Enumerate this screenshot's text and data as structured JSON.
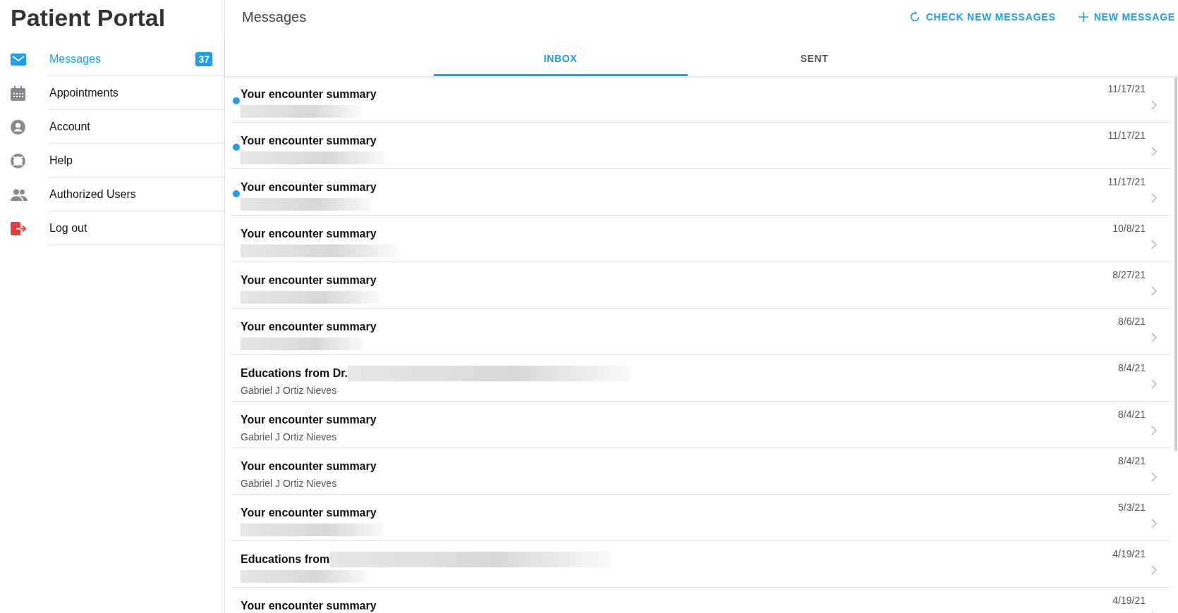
{
  "sidebar": {
    "title": "Patient Portal",
    "items": [
      {
        "label": "Messages",
        "kind": "mail",
        "selected": true,
        "badge": "37"
      },
      {
        "label": "Appointments",
        "kind": "calendar",
        "selected": false
      },
      {
        "label": "Account",
        "kind": "account",
        "selected": false
      },
      {
        "label": "Help",
        "kind": "help",
        "selected": false
      },
      {
        "label": "Authorized Users",
        "kind": "users",
        "selected": false
      },
      {
        "label": "Log out",
        "kind": "logout",
        "selected": false
      }
    ]
  },
  "header": {
    "title": "Messages",
    "actions": [
      {
        "label": "CHECK NEW MESSAGES",
        "kind": "refresh"
      },
      {
        "label": "NEW MESSAGE",
        "kind": "plus"
      }
    ]
  },
  "tabs": [
    {
      "label": "INBOX",
      "selected": true
    },
    {
      "label": "SENT",
      "selected": false
    }
  ],
  "messages": [
    {
      "title": "Your encounter summary",
      "title_redacted": false,
      "sender_redacted": true,
      "unread": true,
      "date": "11/17/21"
    },
    {
      "title": "Your encounter summary",
      "title_redacted": false,
      "sender_redacted": true,
      "unread": true,
      "date": "11/17/21"
    },
    {
      "title": "Your encounter summary",
      "title_redacted": false,
      "sender_redacted": true,
      "unread": true,
      "date": "11/17/21"
    },
    {
      "title": "Your encounter summary",
      "title_redacted": false,
      "sender_redacted": true,
      "unread": false,
      "date": "10/8/21"
    },
    {
      "title": "Your encounter summary",
      "title_redacted": false,
      "sender_redacted": true,
      "unread": false,
      "date": "8/27/21"
    },
    {
      "title": "Your encounter summary",
      "title_redacted": false,
      "sender_redacted": true,
      "unread": false,
      "date": "8/6/21"
    },
    {
      "title": "Educations from Dr.",
      "title_redacted": true,
      "sender": "Gabriel J Ortiz Nieves",
      "sender_redacted": false,
      "unread": false,
      "date": "8/4/21"
    },
    {
      "title": "Your encounter summary",
      "title_redacted": false,
      "sender": "Gabriel J Ortiz Nieves",
      "sender_redacted": false,
      "unread": false,
      "date": "8/4/21"
    },
    {
      "title": "Your encounter summary",
      "title_redacted": false,
      "sender": "Gabriel J Ortiz Nieves",
      "sender_redacted": false,
      "unread": false,
      "date": "8/4/21"
    },
    {
      "title": "Your encounter summary",
      "title_redacted": false,
      "sender_redacted": true,
      "unread": false,
      "date": "5/3/21"
    },
    {
      "title": "Educations from",
      "title_redacted": true,
      "sender_redacted": true,
      "unread": false,
      "date": "4/19/21"
    },
    {
      "title": "Your encounter summary",
      "title_redacted": false,
      "sender_redacted": false,
      "unread": false,
      "date": "4/19/21"
    }
  ]
}
